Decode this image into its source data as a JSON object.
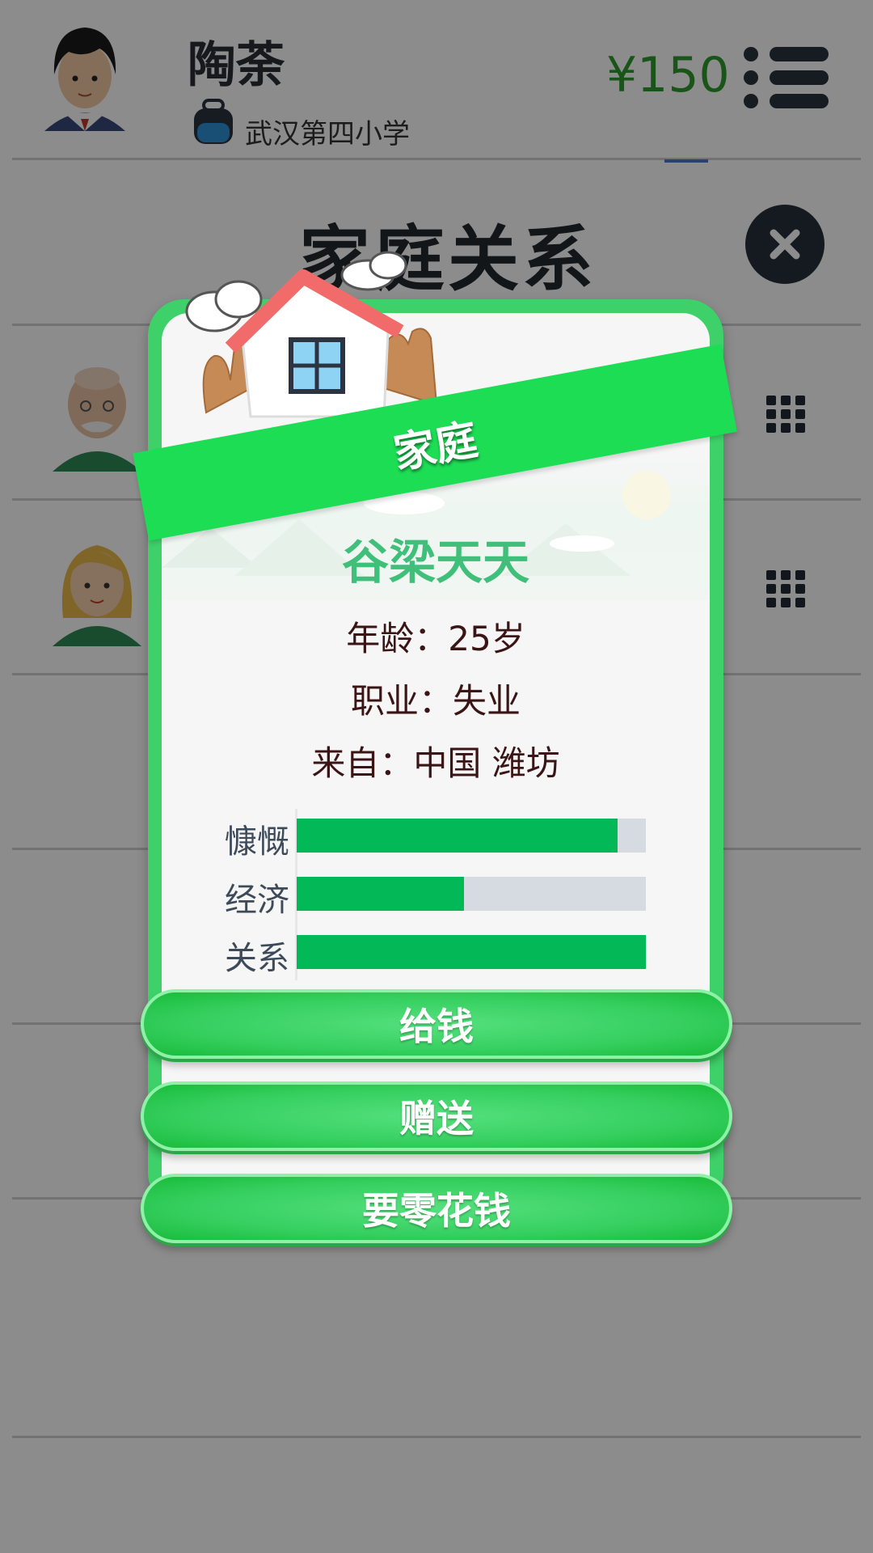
{
  "header": {
    "player_name": "陶荼",
    "school": "武汉第四小学",
    "money": "¥150"
  },
  "page": {
    "title": "家庭关系"
  },
  "dialog": {
    "banner": "家庭",
    "person_name": "谷梁天天",
    "info": [
      {
        "label": "年龄：",
        "value": "25岁"
      },
      {
        "label": "职业：",
        "value": "失业"
      },
      {
        "label": "来自：",
        "value": "中国 潍坊"
      }
    ],
    "stats": [
      {
        "label": "慷慨",
        "level": 0.92
      },
      {
        "label": "经济",
        "level": 0.48
      },
      {
        "label": "关系",
        "level": 1.0
      }
    ],
    "buttons": [
      "给钱",
      "赠送",
      "要零花钱"
    ]
  },
  "colors": {
    "accent_green": "#1ddd55",
    "stat_fill": "#03b957",
    "money": "#2e9b2e"
  }
}
